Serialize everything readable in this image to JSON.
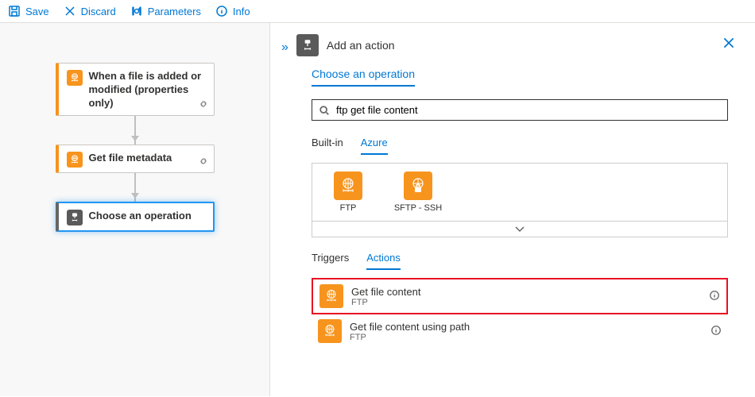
{
  "toolbar": {
    "save": "Save",
    "discard": "Discard",
    "parameters": "Parameters",
    "info": "Info"
  },
  "canvas": {
    "trigger": {
      "title": "When a file is added or modified (properties only)"
    },
    "action1": {
      "title": "Get file metadata"
    },
    "choose": {
      "title": "Choose an operation"
    }
  },
  "panel": {
    "title": "Add an action",
    "subtitle": "Choose an operation",
    "search": {
      "value": "ftp get file content"
    },
    "tabs": {
      "builtin": "Built-in",
      "azure": "Azure"
    },
    "connectors": {
      "ftp": "FTP",
      "sftp": "SFTP - SSH"
    },
    "tabs2": {
      "triggers": "Triggers",
      "actions": "Actions"
    },
    "actions": [
      {
        "title": "Get file content",
        "sub": "FTP"
      },
      {
        "title": "Get file content using path",
        "sub": "FTP"
      }
    ]
  }
}
